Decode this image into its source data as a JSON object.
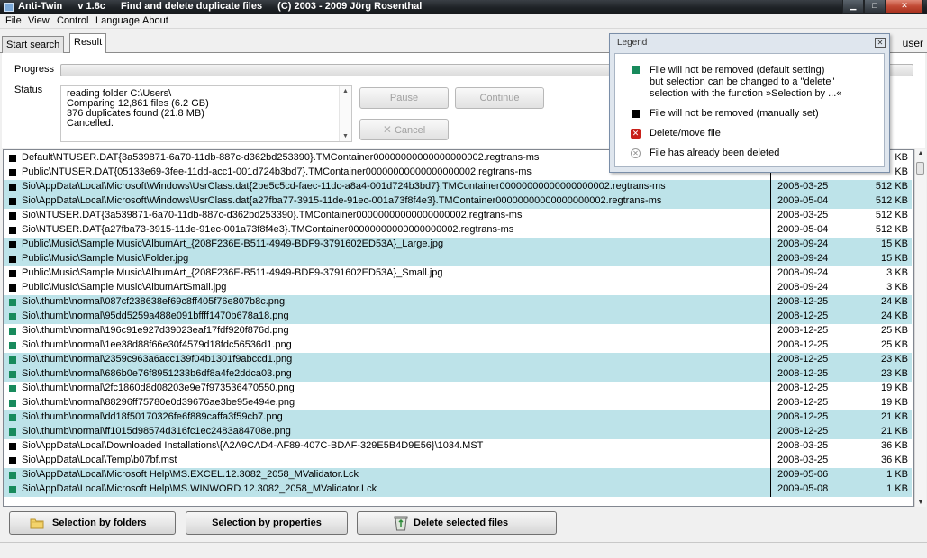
{
  "window": {
    "title": "Anti-Twin",
    "version": "v 1.8c",
    "subtitle": "Find and delete duplicate files",
    "copyright": "(C) 2003 - 2009  Jörg Rosenthal"
  },
  "menu": [
    "File",
    "View",
    "Control",
    "Language",
    "About"
  ],
  "tabs": [
    "Start search",
    "Result"
  ],
  "top_right_text": "user",
  "progress": {
    "label": "Progress",
    "value": 0
  },
  "status": {
    "label": "Status",
    "lines": [
      "reading folder C:\\Users\\",
      "Comparing 12,861 files (6.2 GB)",
      "376 duplicates found (21.8 MB)",
      "Cancelled."
    ]
  },
  "buttons": {
    "pause": "Pause",
    "continue": "Continue",
    "cancel": "Cancel"
  },
  "rows": [
    {
      "mark": "black",
      "path": "Default\\NTUSER.DAT{3a539871-6a70-11db-887c-d362bd253390}.TMContainer00000000000000000002.regtrans-ms",
      "date": "",
      "size": "KB"
    },
    {
      "mark": "black",
      "path": "Public\\NTUSER.DAT{05133e69-3fee-11dd-acc1-001d724b3bd7}.TMContainer00000000000000000002.regtrans-ms",
      "date": "",
      "size": "KB"
    },
    {
      "mark": "black",
      "path": "Sio\\AppData\\Local\\Microsoft\\Windows\\UsrClass.dat{2be5c5cd-faec-11dc-a8a4-001d724b3bd7}.TMContainer00000000000000000002.regtrans-ms",
      "date": "2008-03-25",
      "size": "512 KB"
    },
    {
      "mark": "black",
      "path": "Sio\\AppData\\Local\\Microsoft\\Windows\\UsrClass.dat{a27fba77-3915-11de-91ec-001a73f8f4e3}.TMContainer00000000000000000002.regtrans-ms",
      "date": "2009-05-04",
      "size": "512 KB"
    },
    {
      "mark": "black",
      "path": "Sio\\NTUSER.DAT{3a539871-6a70-11db-887c-d362bd253390}.TMContainer00000000000000000002.regtrans-ms",
      "date": "2008-03-25",
      "size": "512 KB"
    },
    {
      "mark": "black",
      "path": "Sio\\NTUSER.DAT{a27fba73-3915-11de-91ec-001a73f8f4e3}.TMContainer00000000000000000002.regtrans-ms",
      "date": "2009-05-04",
      "size": "512 KB"
    },
    {
      "mark": "black",
      "path": "Public\\Music\\Sample Music\\AlbumArt_{208F236E-B511-4949-BDF9-3791602ED53A}_Large.jpg",
      "date": "2008-09-24",
      "size": "15 KB"
    },
    {
      "mark": "black",
      "path": "Public\\Music\\Sample Music\\Folder.jpg",
      "date": "2008-09-24",
      "size": "15 KB"
    },
    {
      "mark": "black",
      "path": "Public\\Music\\Sample Music\\AlbumArt_{208F236E-B511-4949-BDF9-3791602ED53A}_Small.jpg",
      "date": "2008-09-24",
      "size": "3 KB"
    },
    {
      "mark": "black",
      "path": "Public\\Music\\Sample Music\\AlbumArtSmall.jpg",
      "date": "2008-09-24",
      "size": "3 KB"
    },
    {
      "mark": "green",
      "path": "Sio\\.thumb\\normal\\087cf238638ef69c8ff405f76e807b8c.png",
      "date": "2008-12-25",
      "size": "24 KB"
    },
    {
      "mark": "green",
      "path": "Sio\\.thumb\\normal\\95dd5259a488e091bffff1470b678a18.png",
      "date": "2008-12-25",
      "size": "24 KB"
    },
    {
      "mark": "green",
      "path": "Sio\\.thumb\\normal\\196c91e927d39023eaf17fdf920f876d.png",
      "date": "2008-12-25",
      "size": "25 KB"
    },
    {
      "mark": "green",
      "path": "Sio\\.thumb\\normal\\1ee38d88f66e30f4579d18fdc56536d1.png",
      "date": "2008-12-25",
      "size": "25 KB"
    },
    {
      "mark": "green",
      "path": "Sio\\.thumb\\normal\\2359c963a6acc139f04b1301f9abccd1.png",
      "date": "2008-12-25",
      "size": "23 KB"
    },
    {
      "mark": "green",
      "path": "Sio\\.thumb\\normal\\686b0e76f8951233b6df8a4fe2ddca03.png",
      "date": "2008-12-25",
      "size": "23 KB"
    },
    {
      "mark": "green",
      "path": "Sio\\.thumb\\normal\\2fc1860d8d08203e9e7f973536470550.png",
      "date": "2008-12-25",
      "size": "19 KB"
    },
    {
      "mark": "green",
      "path": "Sio\\.thumb\\normal\\88296ff75780e0d39676ae3be95e494e.png",
      "date": "2008-12-25",
      "size": "19 KB"
    },
    {
      "mark": "green",
      "path": "Sio\\.thumb\\normal\\dd18f50170326fe6f889caffa3f59cb7.png",
      "date": "2008-12-25",
      "size": "21 KB"
    },
    {
      "mark": "green",
      "path": "Sio\\.thumb\\normal\\ff1015d98574d316fc1ec2483a84708e.png",
      "date": "2008-12-25",
      "size": "21 KB"
    },
    {
      "mark": "black",
      "path": "Sio\\AppData\\Local\\Downloaded Installations\\{A2A9CAD4-AF89-407C-BDAF-329E5B4D9E56}\\1034.MST",
      "date": "2008-03-25",
      "size": "36 KB"
    },
    {
      "mark": "black",
      "path": "Sio\\AppData\\Local\\Temp\\b07bf.mst",
      "date": "2008-03-25",
      "size": "36 KB"
    },
    {
      "mark": "green",
      "path": "Sio\\AppData\\Local\\Microsoft Help\\MS.EXCEL.12.3082_2058_MValidator.Lck",
      "date": "2009-05-06",
      "size": "1 KB"
    },
    {
      "mark": "green",
      "path": "Sio\\AppData\\Local\\Microsoft Help\\MS.WINWORD.12.3082_2058_MValidator.Lck",
      "date": "2009-05-08",
      "size": "1 KB"
    }
  ],
  "bottom_buttons": {
    "by_folders": "Selection by folders",
    "by_properties": "Selection by properties",
    "delete": "Delete selected files"
  },
  "legend": {
    "title": "Legend",
    "items": [
      {
        "icon": "green-square",
        "lines": [
          "File will not be removed (default setting)",
          "but selection can be changed to a \"delete\"",
          "selection with the function »Selection by ...«"
        ]
      },
      {
        "icon": "black-square",
        "lines": [
          "File will not be removed (manually set)"
        ]
      },
      {
        "icon": "red-x-box",
        "lines": [
          "Delete/move file"
        ]
      },
      {
        "icon": "grey-x-circle",
        "lines": [
          "File has already been deleted"
        ]
      }
    ]
  },
  "colors": {
    "row_highlight": "#bde3e9",
    "mark_green": "#188a5c",
    "mark_black": "#000000",
    "delete_red": "#c8201a"
  }
}
